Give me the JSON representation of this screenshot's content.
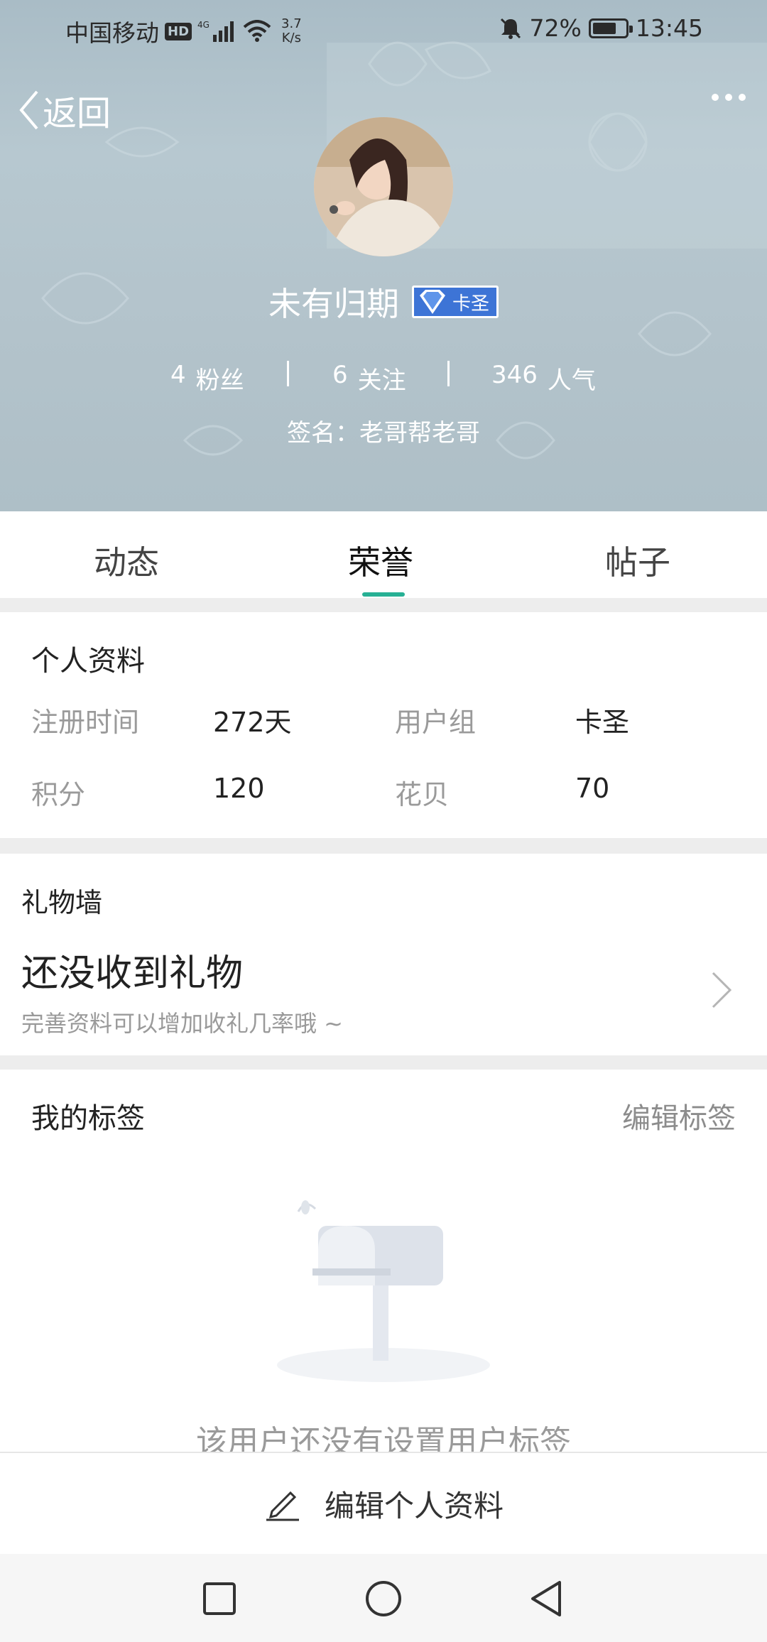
{
  "status_bar": {
    "carrier": "中国移动",
    "hd": "HD",
    "network": "4G",
    "speed_value": "3.7",
    "speed_unit": "K/s",
    "battery": "72%",
    "battery_level": 0.72,
    "time": "13:45"
  },
  "header": {
    "back_label": "返回",
    "username": "未有归期",
    "badge_label": "卡圣",
    "stats": [
      {
        "count": "4",
        "label": "粉丝"
      },
      {
        "count": "6",
        "label": "关注"
      },
      {
        "count": "346",
        "label": "人气"
      }
    ],
    "signature": "签名：老哥帮老哥"
  },
  "tabs": [
    {
      "label": "动态"
    },
    {
      "label": "荣誉",
      "active": true
    },
    {
      "label": "帖子"
    }
  ],
  "profile": {
    "title": "个人资料",
    "register_label": "注册时间",
    "register_value": "272天",
    "group_label": "用户组",
    "group_value": "卡圣",
    "points_label": "积分",
    "points_value": "120",
    "shells_label": "花贝",
    "shells_value": "70"
  },
  "gift_wall": {
    "title": "礼物墙",
    "empty_title": "还没收到礼物",
    "hint": "完善资料可以增加收礼几率哦 ~"
  },
  "tags": {
    "title": "我的标签",
    "edit_label": "编辑标签",
    "empty_text": "该用户还没有设置用户标签"
  },
  "bottom_bar": {
    "edit_profile_label": "编辑个人资料"
  },
  "colors": {
    "accent": "#27b094",
    "header_bg": "#b3c3cb",
    "badge_bg": "#3d74d6"
  }
}
